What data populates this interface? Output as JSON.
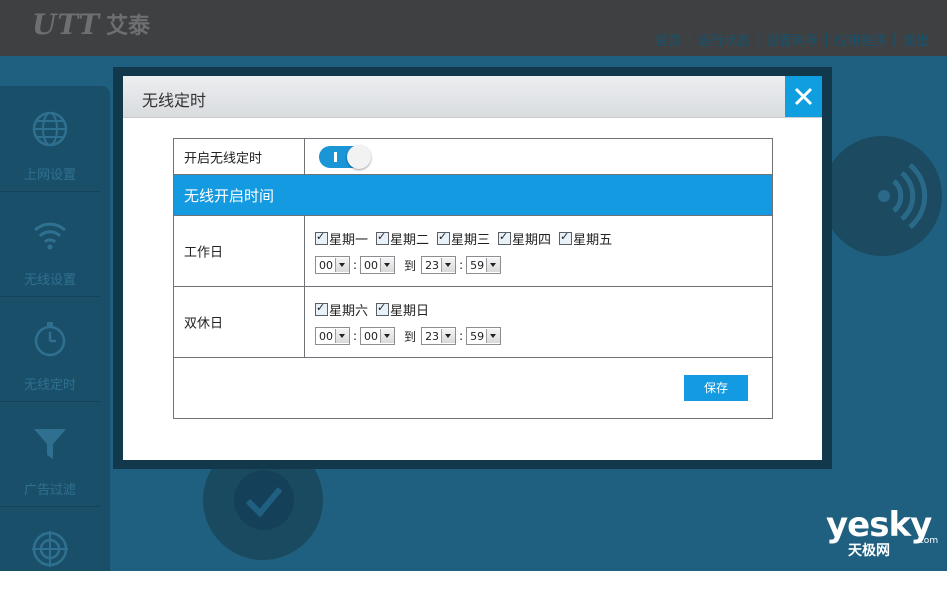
{
  "app": {
    "logo_mark": "UTT",
    "logo_text": "艾泰"
  },
  "topnav": {
    "items": [
      "首页",
      "运行状态",
      "设置向导",
      "应用程序",
      "退出"
    ],
    "separator": "|"
  },
  "sidebar": {
    "items": [
      {
        "label": "上网设置",
        "icon": "globe-icon"
      },
      {
        "label": "无线设置",
        "icon": "wifi-icon"
      },
      {
        "label": "无线定时",
        "icon": "stopwatch-icon"
      },
      {
        "label": "广告过滤",
        "icon": "funnel-icon"
      },
      {
        "label": "",
        "icon": "target-icon"
      }
    ]
  },
  "modal": {
    "title": "无线定时",
    "enable_label": "开启无线定时",
    "enable_state": "on",
    "section_title": "无线开启时间",
    "workday": {
      "label": "工作日",
      "days": [
        "星期一",
        "星期二",
        "星期三",
        "星期四",
        "星期五"
      ],
      "start_hour": "00",
      "start_min": "00",
      "to_label": "到",
      "end_hour": "23",
      "end_min": "59"
    },
    "weekend": {
      "label": "双休日",
      "days": [
        "星期六",
        "星期日"
      ],
      "start_hour": "00",
      "start_min": "00",
      "to_label": "到",
      "end_hour": "23",
      "end_min": "59"
    },
    "colon": ":",
    "save_label": "保存"
  },
  "watermark": {
    "main": "yesky",
    "sub": "天极网",
    "com": ".com"
  },
  "colors": {
    "accent": "#139ae0",
    "close": "#0f9fe0",
    "background": "#1f5f7f"
  }
}
